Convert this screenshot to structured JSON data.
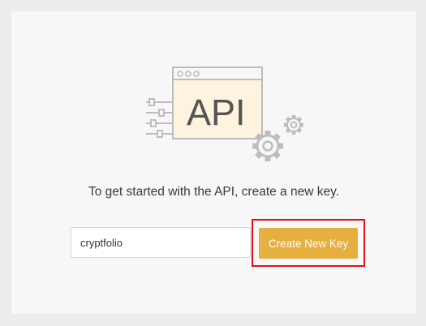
{
  "illustration": {
    "icon": "api-window-gears-icon",
    "text": "API"
  },
  "intro": {
    "text": "To get started with the API, create a new key."
  },
  "key_form": {
    "input_value": "cryptfolio",
    "button_label": "Create New Key"
  },
  "colors": {
    "page_background": "#ececec",
    "card_background": "#f7f7f7",
    "button": "#e5b040",
    "button_text": "#ffffff",
    "highlight_border": "#e0101a",
    "illustration_stroke": "#bdbdbd",
    "illustration_fill": "#fdf3df"
  }
}
